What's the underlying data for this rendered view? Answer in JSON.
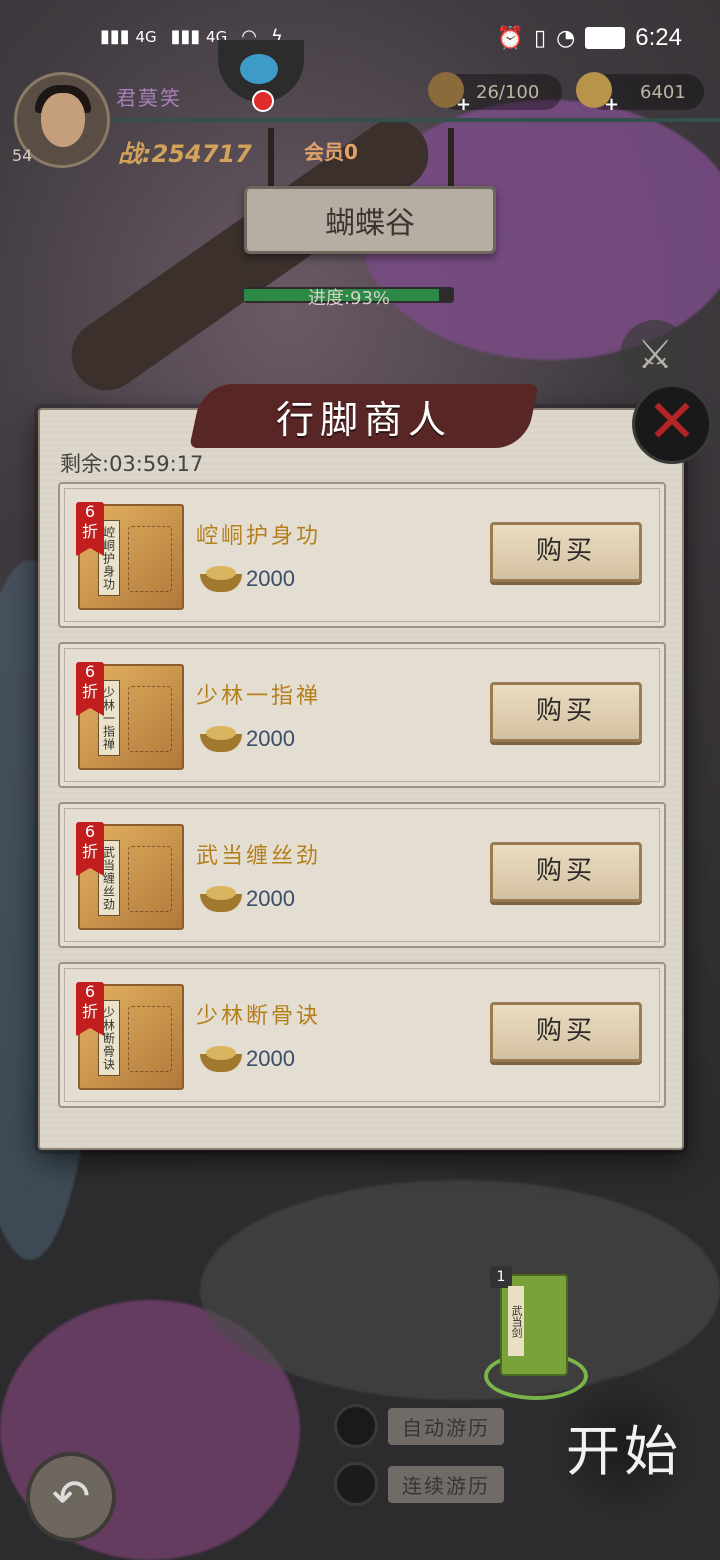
{
  "status_bar": {
    "signal1": "4G",
    "signal2": "4G",
    "time": "6:24"
  },
  "player": {
    "name": "君莫笑",
    "level": "54",
    "power": "战:254717",
    "vip": "会员0"
  },
  "resources": {
    "stamina": "26/100",
    "gold": "6401"
  },
  "location": {
    "name": "蝴蝶谷",
    "progress_label": "进度:93%",
    "progress_value": 0.93
  },
  "shop": {
    "title": "行脚商人",
    "timer": "剩余:03:59:17",
    "discount_number": "6",
    "discount_char": "折",
    "buy_label": "购买",
    "items": [
      {
        "name": "崆峒护身功",
        "spine": "崆峒护身功",
        "price": "2000"
      },
      {
        "name": "少林一指禅",
        "spine": "少林一指禅",
        "price": "2000"
      },
      {
        "name": "武当缠丝劲",
        "spine": "武当缠丝劲",
        "price": "2000"
      },
      {
        "name": "少林断骨诀",
        "spine": "少林断骨诀",
        "price": "2000"
      }
    ]
  },
  "bottom": {
    "card_count": "1",
    "card_spine": "武当剑",
    "auto_travel": "自动游历",
    "continuous_travel": "连续游历",
    "start": "开始"
  },
  "icons": {
    "close": "close-icon",
    "back": "back-arrow-icon",
    "gold": "gold-ingot-icon",
    "stamina": "gourd-icon",
    "sword": "crossed-swords-icon"
  },
  "colors": {
    "item_name": "#b57f1c",
    "banner": "#592626",
    "progress": "#2c8a46",
    "discount": "#c21e1e"
  }
}
